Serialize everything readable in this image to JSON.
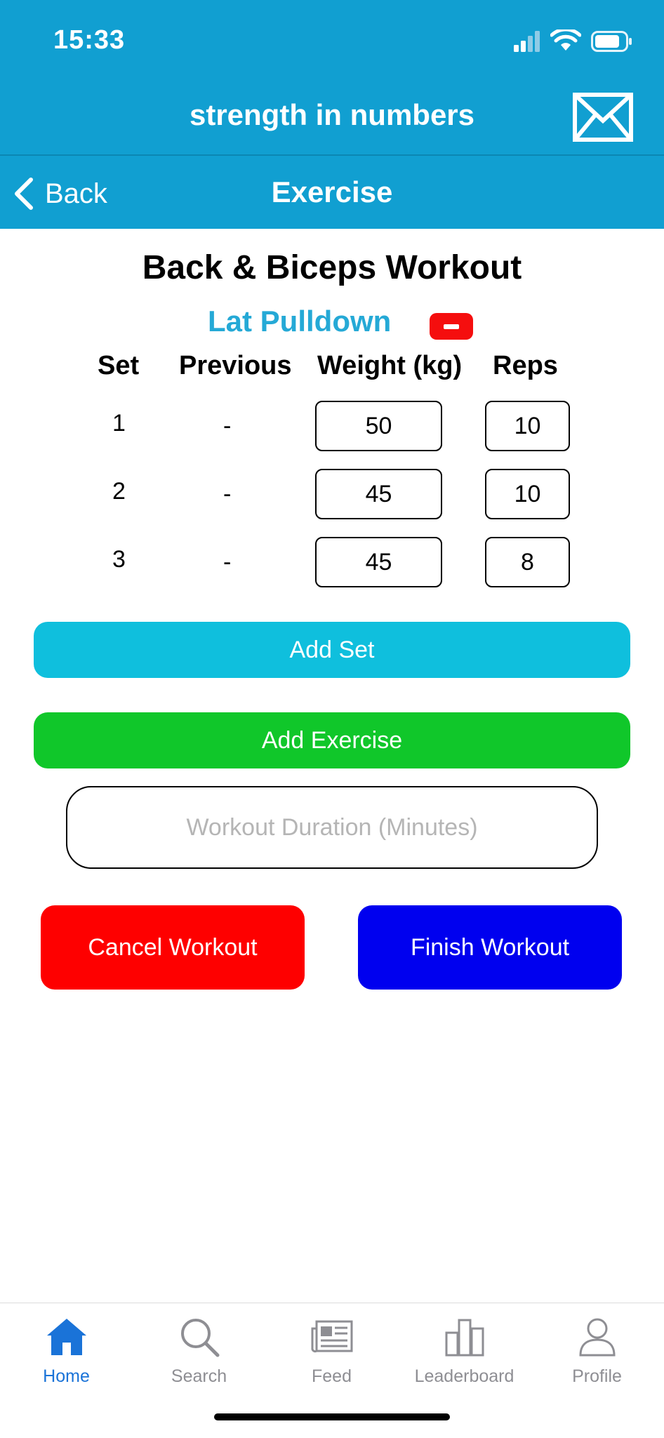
{
  "status_bar": {
    "time": "15:33"
  },
  "header": {
    "brand": "strength in numbers",
    "mail_icon": "envelope-icon"
  },
  "nav": {
    "back_label": "Back",
    "title": "Exercise"
  },
  "workout": {
    "title": "Back & Biceps Workout",
    "exercise_name": "Lat Pulldown",
    "columns": {
      "set": "Set",
      "previous": "Previous",
      "weight": "Weight (kg)",
      "reps": "Reps"
    },
    "sets": [
      {
        "set": "1",
        "previous": "-",
        "weight": "50",
        "reps": "10"
      },
      {
        "set": "2",
        "previous": "-",
        "weight": "45",
        "reps": "10"
      },
      {
        "set": "3",
        "previous": "-",
        "weight": "45",
        "reps": "8"
      }
    ]
  },
  "actions": {
    "add_set": "Add Set",
    "add_exercise": "Add Exercise",
    "duration_placeholder": "Workout Duration (Minutes)",
    "cancel": "Cancel Workout",
    "finish": "Finish Workout"
  },
  "tabbar": {
    "items": [
      {
        "label": "Home",
        "icon": "home-icon",
        "active": true
      },
      {
        "label": "Search",
        "icon": "search-icon",
        "active": false
      },
      {
        "label": "Feed",
        "icon": "newspaper-icon",
        "active": false
      },
      {
        "label": "Leaderboard",
        "icon": "bar-chart-icon",
        "active": false
      },
      {
        "label": "Profile",
        "icon": "person-icon",
        "active": false
      }
    ]
  },
  "colors": {
    "header": "#119fd1",
    "add_set": "#0fbfdd",
    "add_exercise": "#10c72a",
    "cancel": "#fe0000",
    "finish": "#0000ef",
    "active_tab": "#1a73d8"
  }
}
